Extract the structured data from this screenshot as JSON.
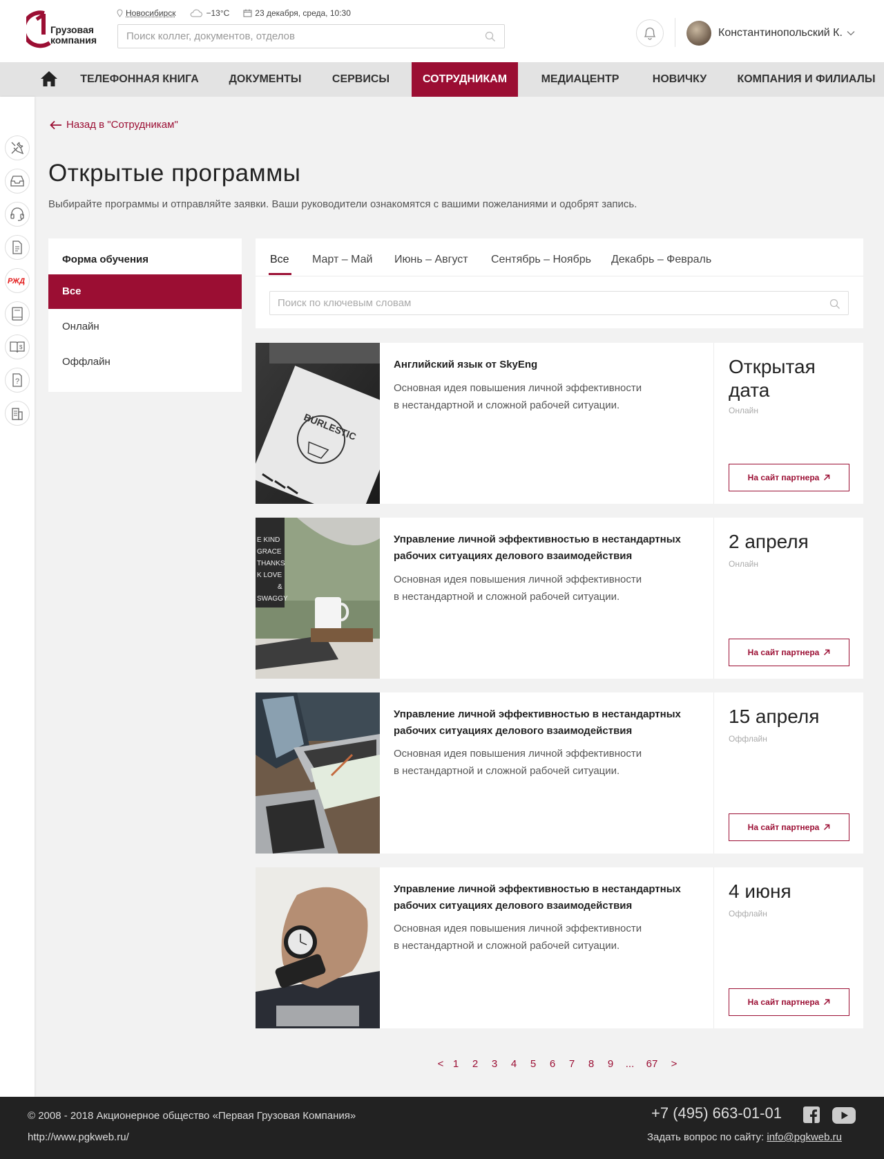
{
  "header": {
    "logo_line1": "Грузовая",
    "logo_line2": "компания",
    "city": "Новосибирск",
    "weather": "−13°С",
    "datetime": "23 декабря, среда, 10:30",
    "search_placeholder": "Поиск коллег, документов, отделов",
    "user_name": "Константинопольский К."
  },
  "nav": {
    "items": [
      {
        "label": "ТЕЛЕФОННАЯ КНИГА"
      },
      {
        "label": "ДОКУМЕНТЫ"
      },
      {
        "label": "СЕРВИСЫ"
      },
      {
        "label": "СОТРУДНИКАМ",
        "active": true
      },
      {
        "label": "МЕДИАЦЕНТР"
      },
      {
        "label": "НОВИЧКУ"
      },
      {
        "label": "КОМПАНИЯ И ФИЛИАЛЫ"
      }
    ]
  },
  "rail": {
    "icons": [
      "tools-icon",
      "inbox-icon",
      "headset-icon",
      "document-icon",
      "rzd-logo-icon",
      "book-icon",
      "ledger-icon",
      "help-icon",
      "building-icon"
    ],
    "rzd_text": "РЖД"
  },
  "page": {
    "back_label": "Назад в \"Сотрудникам\"",
    "title": "Открытые программы",
    "subtitle": "Выбирайте программы и отправляйте заявки. Ваши руководители ознакомятся с вашими пожеланиями и одобрят запись."
  },
  "filter": {
    "title": "Форма обучения",
    "options": [
      {
        "label": "Все",
        "active": true
      },
      {
        "label": "Онлайн"
      },
      {
        "label": "Оффлайн"
      }
    ]
  },
  "tabs": {
    "items": [
      {
        "label": "Все",
        "active": true
      },
      {
        "label": "Март – Май"
      },
      {
        "label": "Июнь – Август"
      },
      {
        "label": "Сентябрь – Ноябрь"
      },
      {
        "label": "Декабрь – Февраль"
      }
    ],
    "search_placeholder": "Поиск по ключевым словам"
  },
  "cards": [
    {
      "title": "Английский язык от SkyEng",
      "desc1": "Основная идея повышения личной эффективности",
      "desc2": "в нестандартной и сложной рабочей ситуации.",
      "date": "Открытая дата",
      "mode": "Онлайн",
      "button": "На сайт партнера",
      "image_text": "BURLESTIC"
    },
    {
      "title": "Управление личной эффективностью в нестандартных рабочих ситуациях делового взаимодействия",
      "desc1": "Основная идея повышения личной эффективности",
      "desc2": "в нестандартной и сложной рабочей ситуации.",
      "date": "2 апреля",
      "mode": "Онлайн",
      "button": "На сайт партнера",
      "image_lines": [
        "E KIND",
        "GRACE",
        "THANKS",
        "K LOVE",
        "&",
        "SWAGGY"
      ]
    },
    {
      "title": "Управление личной эффективностью в нестандартных рабочих ситуациях делового взаимодействия",
      "desc1": "Основная идея повышения личной эффективности",
      "desc2": "в нестандартной и сложной рабочей ситуации.",
      "date": "15 апреля",
      "mode": "Оффлайн",
      "button": "На сайт партнера"
    },
    {
      "title": "Управление личной эффективностью в нестандартных рабочих ситуациях делового взаимодействия",
      "desc1": "Основная идея повышения личной эффективности",
      "desc2": "в нестандартной и сложной рабочей ситуации.",
      "date": "4 июня",
      "mode": "Оффлайн",
      "button": "На сайт партнера"
    }
  ],
  "pagination": {
    "prev": "<",
    "pages": [
      "1",
      "2",
      "3",
      "4",
      "5",
      "6",
      "7",
      "8",
      "9",
      "...",
      "67"
    ],
    "next": ">"
  },
  "footer": {
    "copyright": "© 2008 - 2018 Акционерное общество «Первая Грузовая Компания»",
    "url": "http://www.pgkweb.ru/",
    "phone": "+7 (495) 663-01-01",
    "ask_label": "Задать вопрос по сайту:",
    "email": "info@pgkweb.ru"
  },
  "colors": {
    "brand": "#9b0e33",
    "nav_bg": "#e3e3e3",
    "page_bg": "#f2f2f2",
    "footer_bg": "#222222"
  }
}
